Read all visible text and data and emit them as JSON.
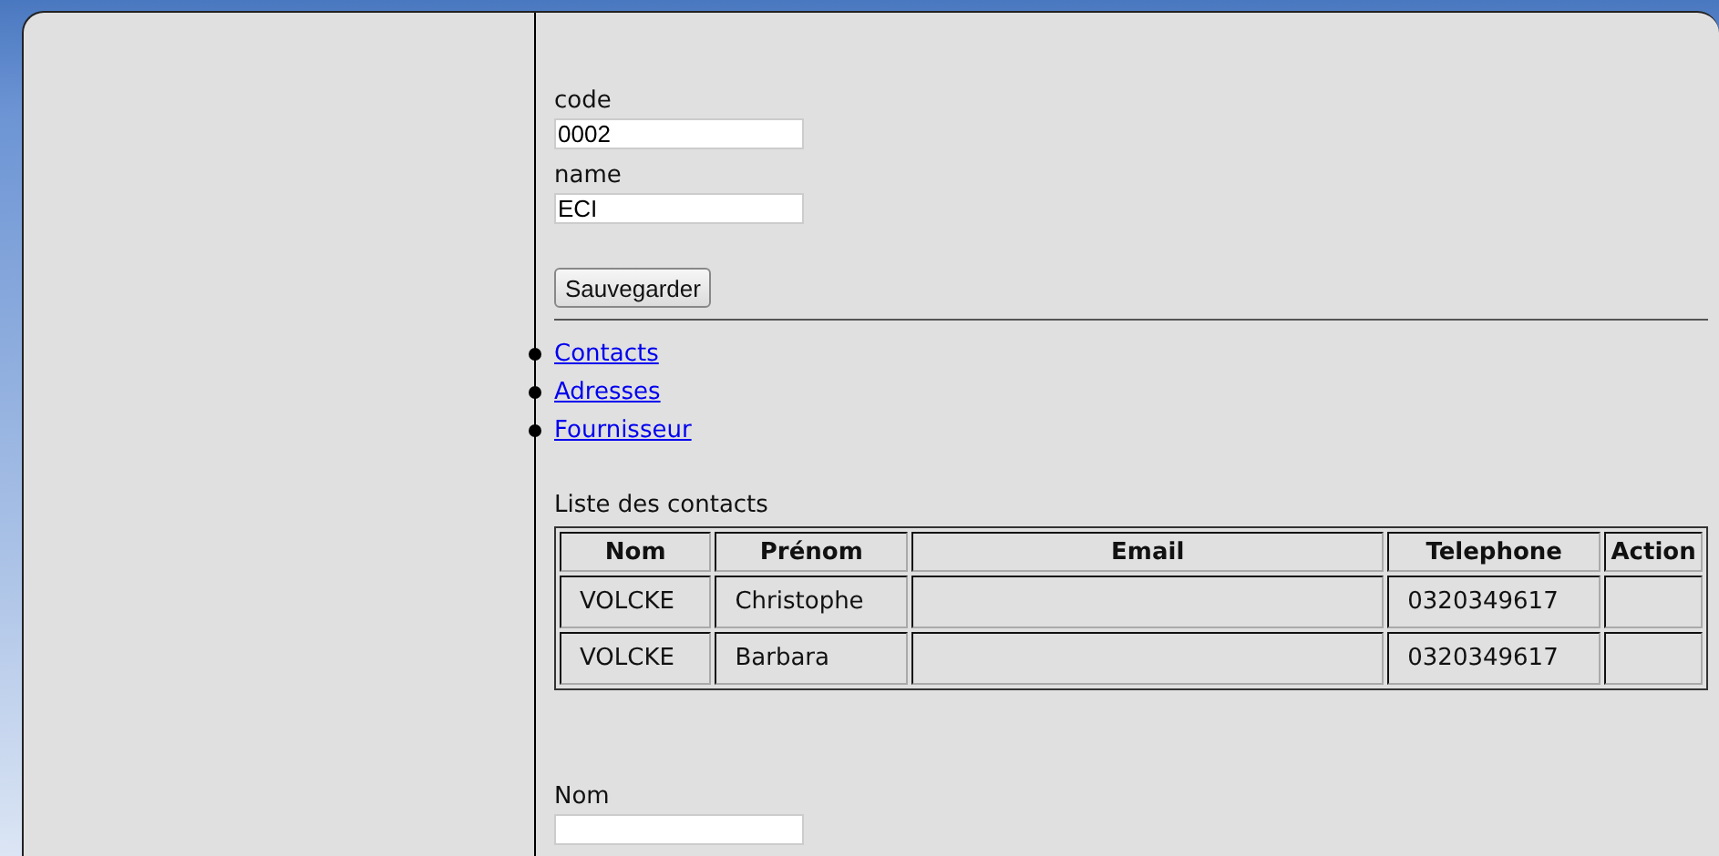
{
  "form": {
    "fields": [
      {
        "label": "code",
        "value": "0002"
      },
      {
        "label": "name",
        "value": "ECI"
      }
    ],
    "save_button": "Sauvegarder"
  },
  "links": [
    "Contacts",
    "Adresses",
    "Fournisseur"
  ],
  "contacts": {
    "title": "Liste des contacts",
    "columns": [
      "Nom",
      "Prénom",
      "Email",
      "Telephone",
      "Action"
    ],
    "rows": [
      [
        "VOLCKE",
        "Christophe",
        null,
        "0320349617",
        null
      ],
      [
        "VOLCKE",
        "Barbara",
        null,
        "0320349617",
        null
      ]
    ]
  },
  "new_contact": {
    "fields": [
      {
        "label": "Nom"
      }
    ]
  }
}
